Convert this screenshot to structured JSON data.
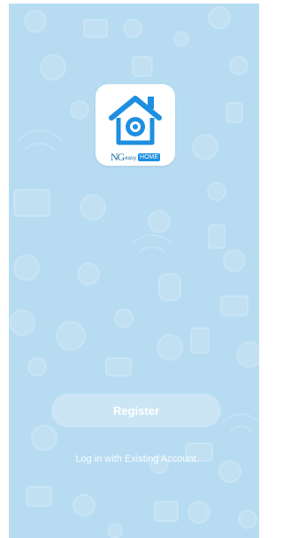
{
  "app": {
    "logo_text_ng": "NG",
    "logo_text_easy": "easy",
    "logo_badge": "HOME"
  },
  "actions": {
    "register_label": "Register",
    "login_label": "Log in with Existing Account"
  },
  "colors": {
    "background": "#b7dcf2",
    "brand_blue": "#1e8fe0"
  }
}
